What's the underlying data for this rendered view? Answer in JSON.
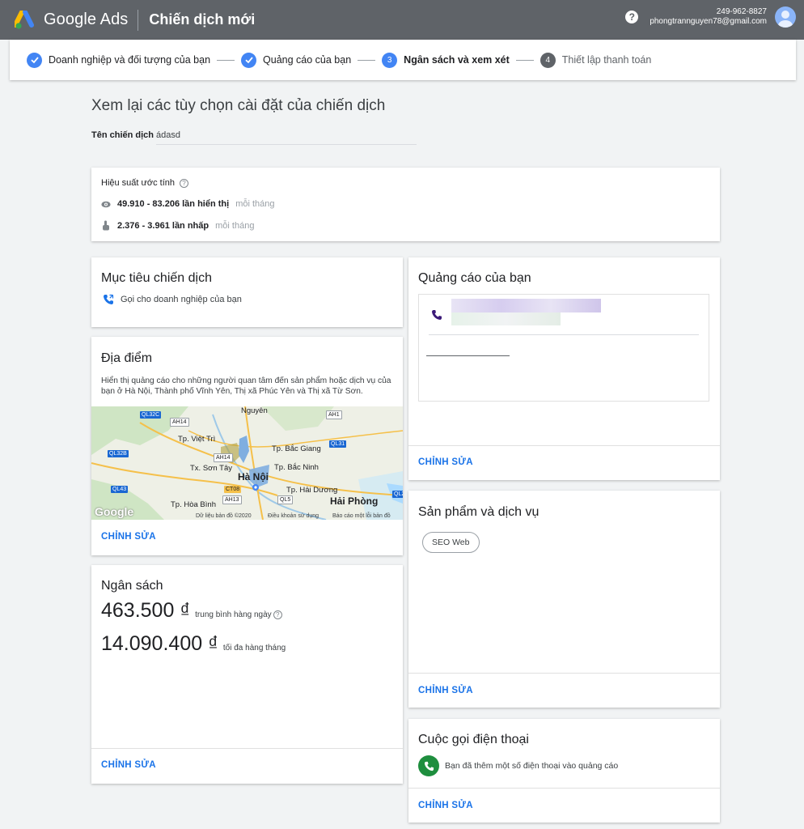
{
  "header": {
    "product_name": "Google Ads",
    "page_title": "Chiến dịch mới",
    "help_symbol": "?",
    "account_id": "249-962-8827",
    "account_email": "phongtrannguyen78@gmail.com"
  },
  "stepper": {
    "steps": [
      {
        "number": "1",
        "label": "Doanh nghiệp và đối tượng của bạn",
        "state": "done"
      },
      {
        "number": "2",
        "label": "Quảng cáo của bạn",
        "state": "done"
      },
      {
        "number": "3",
        "label": "Ngân sách và xem xét",
        "state": "active"
      },
      {
        "number": "4",
        "label": "Thiết lập thanh toán",
        "state": "pending"
      }
    ]
  },
  "review": {
    "title": "Xem lại các tùy chọn cài đặt của chiến dịch",
    "campaign_name_label": "Tên chiến dịch",
    "campaign_name_value": "ádasd"
  },
  "performance": {
    "title": "Hiệu suất ước tính",
    "impressions": "49.910 - 83.206 lần hiển thị",
    "impressions_period": "mỗi tháng",
    "clicks": "2.376 - 3.961 lần nhấp",
    "clicks_period": "mỗi tháng"
  },
  "goal": {
    "title": "Mục tiêu chiến dịch",
    "value": "Gọi cho doanh nghiệp của bạn"
  },
  "location": {
    "title": "Địa điểm",
    "description": "Hiển thị quảng cáo cho những người quan tâm đến sản phẩm hoặc dịch vụ của bạn ở Hà Nội, Thành phố Vĩnh Yên, Thị xã Phúc Yên và Thị xã Từ Sơn.",
    "map": {
      "cities": [
        "Nguyên",
        "Tp. Việt Trì",
        "Tp. Bắc Giang",
        "Tx. Sơn Tây",
        "Tp. Bắc Ninh",
        "Hà Nội",
        "Tp. Hải Dương",
        "Hải Phòng",
        "Tp. Hòa Bình"
      ],
      "roads": [
        "QL32C",
        "AH14",
        "AH1",
        "QL31",
        "QL32B",
        "AH14",
        "QL43",
        "CT08",
        "AH13",
        "QL2",
        "QL5"
      ],
      "attribution": "Dữ liệu bản đồ ©2020",
      "terms": "Điều khoản sử dụng",
      "report": "Báo cáo một lỗi bản đồ",
      "google_mark": "Google"
    },
    "edit_label": "CHỈNH SỬA"
  },
  "budget": {
    "title": "Ngân sách",
    "daily_amount": "463.500 ₫",
    "daily_caption": "trung bình hàng ngày",
    "monthly_amount": "14.090.400 ₫",
    "monthly_caption": "tối đa hàng tháng",
    "edit_label": "CHỈNH SỬA"
  },
  "ads": {
    "title": "Quảng cáo của bạn",
    "edit_label": "CHỈNH SỬA"
  },
  "products": {
    "title": "Sản phẩm và dịch vụ",
    "chips": [
      "SEO Web"
    ],
    "edit_label": "CHỈNH SỬA"
  },
  "calls": {
    "title": "Cuộc gọi điện thoại",
    "value": "Bạn đã thêm một số điện thoại vào quảng cáo",
    "edit_label": "CHỈNH SỬA"
  },
  "colors": {
    "header_bg": "#5f6368",
    "accent_blue": "#1a73e8",
    "step_blue": "#4285f4",
    "call_green": "#1e8e3e"
  }
}
